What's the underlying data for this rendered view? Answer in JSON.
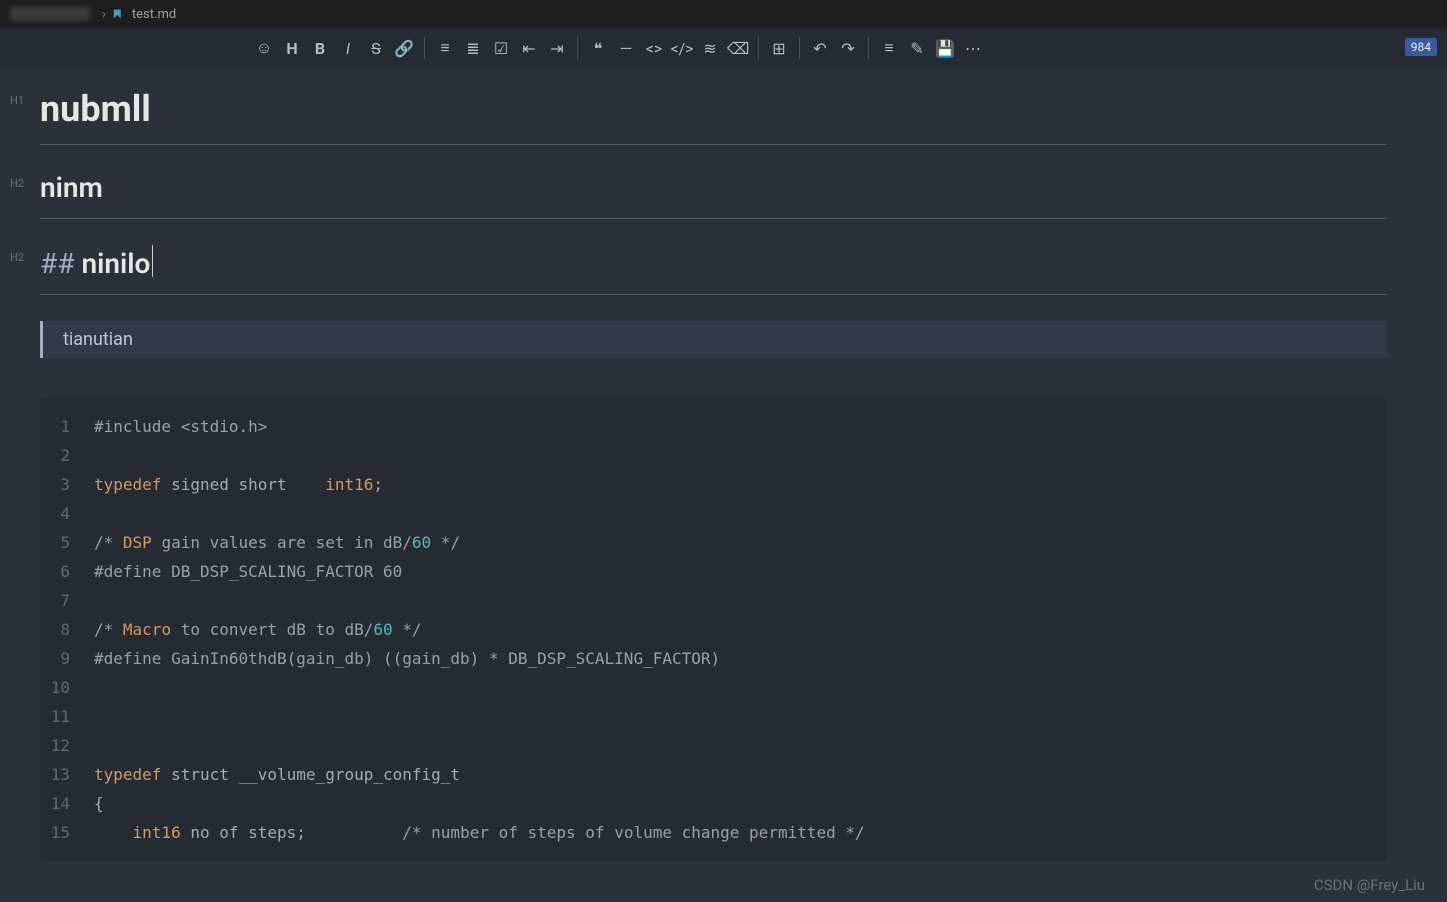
{
  "breadcrumb": {
    "file": "test.md",
    "sep": "›"
  },
  "toolbar": {
    "counter": "984",
    "icons": [
      "emoji",
      "heading",
      "bold",
      "italic",
      "strike",
      "link",
      "|",
      "ul",
      "ol",
      "task",
      "outdent",
      "indent",
      "|",
      "quote",
      "hr",
      "code-pair",
      "code",
      "format",
      "clear",
      "|",
      "table",
      "|",
      "undo",
      "redo",
      "|",
      "align",
      "edit",
      "save",
      "more"
    ]
  },
  "content": {
    "h1": {
      "label": "H1",
      "text": "nubmll"
    },
    "h2a": {
      "label": "H2",
      "text": "ninm"
    },
    "h2b": {
      "label": "H2",
      "prefix": "## ",
      "text": "ninilo"
    },
    "quote": "tianutian"
  },
  "code": {
    "lines": [
      {
        "n": 1,
        "tokens": [
          [
            "cmt",
            "#include <stdio.h>"
          ]
        ]
      },
      {
        "n": 2,
        "tokens": []
      },
      {
        "n": 3,
        "tokens": [
          [
            "kw",
            "typedef"
          ],
          [
            "",
            " signed short    "
          ],
          [
            "ident",
            "int16"
          ],
          [
            "punc",
            ";"
          ]
        ]
      },
      {
        "n": 4,
        "tokens": []
      },
      {
        "n": 5,
        "tokens": [
          [
            "cmt",
            "/* "
          ],
          [
            "ident",
            "DSP"
          ],
          [
            "cmt",
            " gain values are set in dB/"
          ],
          [
            "num",
            "60"
          ],
          [
            "cmt",
            " */"
          ]
        ]
      },
      {
        "n": 6,
        "tokens": [
          [
            "cmt",
            "#define DB_DSP_SCALING_FACTOR 60"
          ]
        ]
      },
      {
        "n": 7,
        "tokens": []
      },
      {
        "n": 8,
        "tokens": [
          [
            "cmt",
            "/* "
          ],
          [
            "ident",
            "Macro"
          ],
          [
            "cmt",
            " to convert dB to dB/"
          ],
          [
            "num",
            "60"
          ],
          [
            "cmt",
            " */"
          ]
        ]
      },
      {
        "n": 9,
        "tokens": [
          [
            "cmt",
            "#define GainIn60thdB(gain_db) ((gain_db) * DB_DSP_SCALING_FACTOR)"
          ]
        ]
      },
      {
        "n": 10,
        "tokens": []
      },
      {
        "n": 11,
        "tokens": []
      },
      {
        "n": 12,
        "tokens": []
      },
      {
        "n": 13,
        "tokens": [
          [
            "kw",
            "typedef"
          ],
          [
            "",
            " struct __volume_group_config_t"
          ]
        ]
      },
      {
        "n": 14,
        "tokens": [
          [
            "punc",
            "{"
          ]
        ]
      },
      {
        "n": 15,
        "tokens": [
          [
            "",
            "    "
          ],
          [
            "typ",
            "int16"
          ],
          [
            "",
            " no of steps;          "
          ],
          [
            "cmt",
            "/* number of steps of volume change permitted */"
          ]
        ]
      }
    ]
  },
  "watermark": "CSDN @Frey_Liu"
}
